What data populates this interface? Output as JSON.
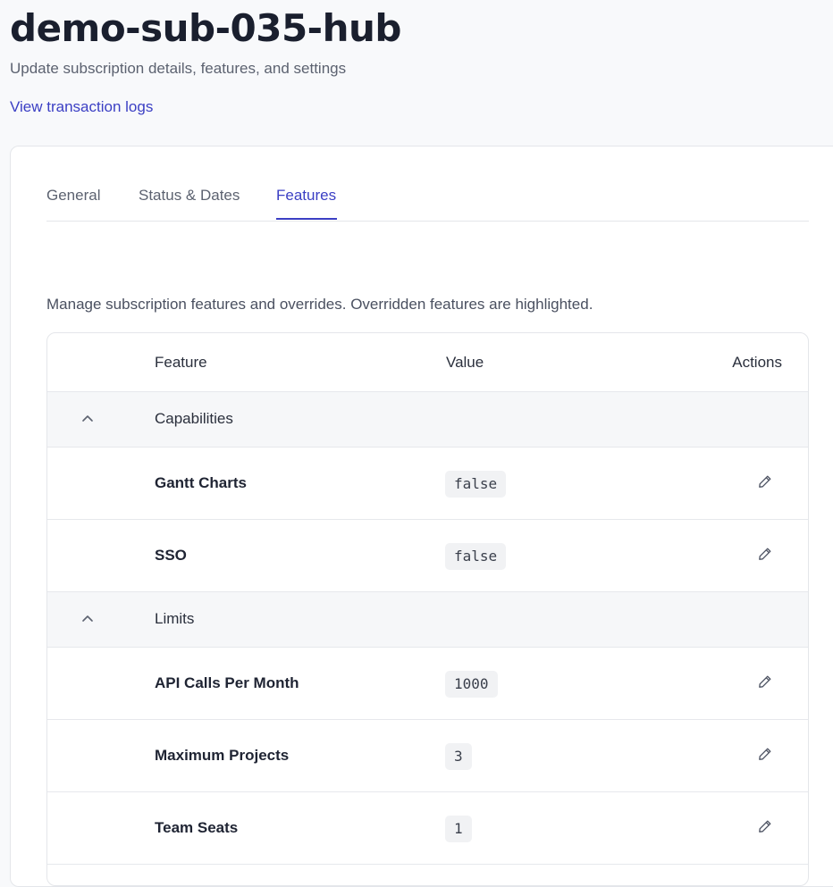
{
  "page": {
    "title": "demo-sub-035-hub",
    "subtitle": "Update subscription details, features, and settings",
    "log_link": "View transaction logs"
  },
  "tabs": [
    {
      "label": "General",
      "active": false
    },
    {
      "label": "Status & Dates",
      "active": false
    },
    {
      "label": "Features",
      "active": true
    }
  ],
  "features": {
    "description": "Manage subscription features and overrides. Overridden features are highlighted.",
    "columns": {
      "feature": "Feature",
      "value": "Value",
      "actions": "Actions"
    },
    "groups": [
      {
        "name": "Capabilities",
        "expanded": true,
        "items": [
          {
            "name": "Gantt Charts",
            "value": "false"
          },
          {
            "name": "SSO",
            "value": "false"
          }
        ]
      },
      {
        "name": "Limits",
        "expanded": true,
        "items": [
          {
            "name": "API Calls Per Month",
            "value": "1000"
          },
          {
            "name": "Maximum Projects",
            "value": "3"
          },
          {
            "name": "Team Seats",
            "value": "1"
          }
        ]
      }
    ]
  },
  "colors": {
    "accent": "#3b3fc4",
    "text": "#1f2433",
    "muted": "#5c6270",
    "border": "#e4e6ea",
    "group_bg": "#f6f7f9"
  },
  "icons": {
    "collapse": "chevron-up-icon",
    "edit": "pencil-icon"
  }
}
